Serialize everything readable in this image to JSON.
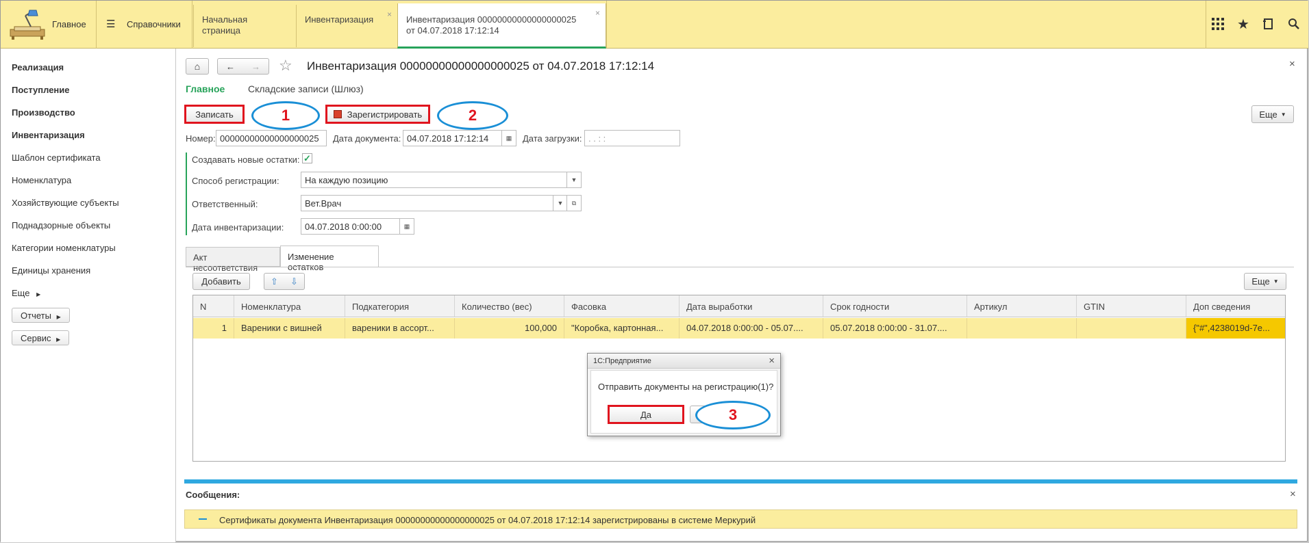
{
  "topbar": {
    "main_label": "Главное",
    "refs_label": "Справочники",
    "tabs": [
      {
        "label": "Начальная страница"
      },
      {
        "label": "Инвентаризация",
        "close": "×"
      },
      {
        "label": "Инвентаризация 00000000000000000025 от 04.07.2018 17:12:14",
        "close": "×"
      }
    ],
    "icons": [
      "apps-grid-icon",
      "star-icon",
      "history-icon",
      "search-icon"
    ]
  },
  "sidebar": {
    "items": [
      {
        "label": "Реализация",
        "bold": true
      },
      {
        "label": "Поступление",
        "bold": true
      },
      {
        "label": "Производство",
        "bold": true
      },
      {
        "label": "Инвентаризация",
        "bold": true
      },
      {
        "label": "Шаблон сертификата",
        "bold": false
      },
      {
        "label": "Номенклатура",
        "bold": false
      },
      {
        "label": "Хозяйствующие субъекты",
        "bold": false
      },
      {
        "label": "Поднадзорные объекты",
        "bold": false
      },
      {
        "label": "Категории номенклатуры",
        "bold": false
      },
      {
        "label": "Единицы хранения",
        "bold": false
      },
      {
        "label": "Еще",
        "bold": false
      }
    ],
    "reports": "Отчеты",
    "service": "Сервис"
  },
  "doc": {
    "title": "Инвентаризация 00000000000000000025 от 04.07.2018 17:12:14",
    "subtab_main": "Главное",
    "subtab_records": "Складские записи (Шлюз)",
    "save_btn": "Записать",
    "register_btn": "Зарегистрировать",
    "more_btn": "Еще",
    "number_label": "Номер:",
    "number_value": "00000000000000000025",
    "date_label": "Дата документа:",
    "date_value": "04.07.2018 17:12:14",
    "load_label": "Дата загрузки:",
    "load_value": " .  .       :  :",
    "create_label": "Создавать новые остатки:",
    "create_checked": "✓",
    "method_label": "Способ регистрации:",
    "method_value": "На каждую позицию",
    "resp_label": "Ответственный:",
    "resp_value": "Вет.Врач",
    "inv_date_label": "Дата инвентаризации:",
    "inv_date_value": "04.07.2018  0:00:00"
  },
  "inner_tabs": [
    "Акт несоответствия",
    "Изменение остатков"
  ],
  "table": {
    "add_btn": "Добавить",
    "more_btn": "Еще",
    "columns": [
      "N",
      "Номенклатура",
      "Подкатегория",
      "Количество (вес)",
      "Фасовка",
      "Дата выработки",
      "Срок годности",
      "Артикул",
      "GTIN",
      "Доп сведения"
    ],
    "rows": [
      [
        "1",
        "Вареники с вишней",
        "вареники в ассорт...",
        "100,000",
        "\"Коробка, картонная...",
        "04.07.2018 0:00:00 - 05.07....",
        "05.07.2018 0:00:00 - 31.07....",
        "",
        "",
        "{\"#\",4238019d-7e..."
      ]
    ]
  },
  "dialog": {
    "title": "1С:Предприятие",
    "question": "Отправить документы на регистрацию(1)?",
    "yes": "Да",
    "close": "×"
  },
  "annotations": [
    "1",
    "2",
    "3"
  ],
  "messages": {
    "header": "Сообщения:",
    "text": "Сертификаты документа Инвентаризация 00000000000000000025 от 04.07.2018 17:12:14 зарегистрированы в системе Меркурий",
    "close": "×"
  },
  "colors": {
    "accent_yellow": "#fbed9e",
    "green": "#27a35a",
    "annot_red": "#e0141e",
    "annot_blue": "#1a8fd6"
  }
}
